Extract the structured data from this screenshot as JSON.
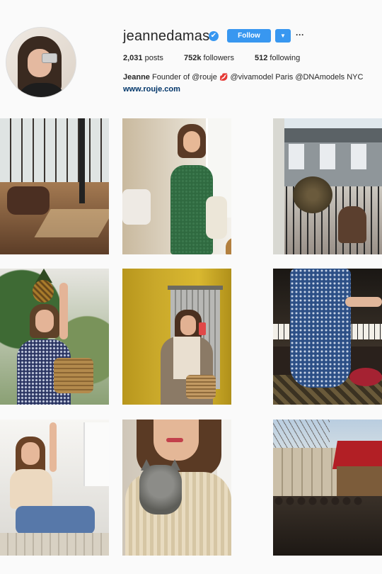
{
  "profile": {
    "username": "jeannedamas",
    "verified_badge": "✔",
    "follow_label": "Follow",
    "dropdown_icon": "chevron-down-icon",
    "more_icon": "more-options-icon",
    "more_label": "···",
    "stats": {
      "posts_count": "2,031",
      "posts_label": "posts",
      "followers_count": "752k",
      "followers_label": "followers",
      "following_count": "512",
      "following_label": "following"
    },
    "bio": {
      "name": "Jeanne",
      "text_1": "Founder of @rouje",
      "lips_icon": "💋",
      "text_2": "@vivamodel Paris @DNAmodels NYC",
      "link": "www.rouje.com"
    }
  },
  "colors": {
    "accent": "#3897f0",
    "text": "#262626",
    "link": "#003569",
    "background": "#fafafa"
  },
  "grid": {
    "posts": [
      {
        "label": "post-loft-interior"
      },
      {
        "label": "post-green-dress"
      },
      {
        "label": "post-paris-balcony-cat"
      },
      {
        "label": "post-pineapple-garden"
      },
      {
        "label": "post-elevator-selfie"
      },
      {
        "label": "post-piano-floral-dress"
      },
      {
        "label": "post-white-room-jeans"
      },
      {
        "label": "post-cat-sweater"
      },
      {
        "label": "post-paris-cafe"
      }
    ]
  }
}
